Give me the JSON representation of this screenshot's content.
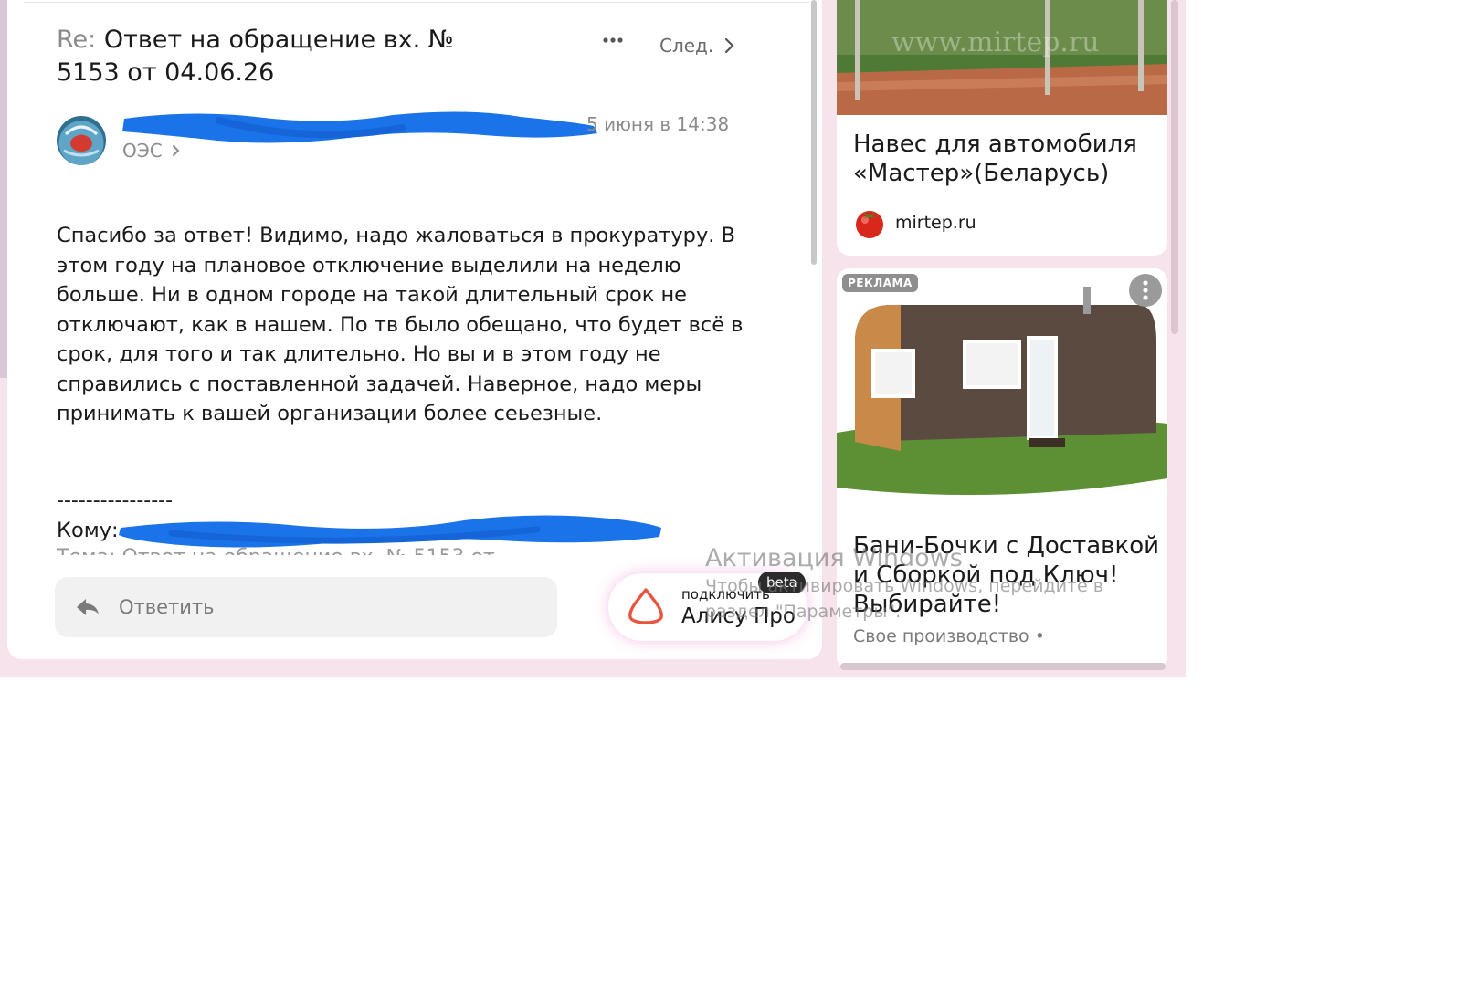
{
  "email": {
    "subject_prefix": "Re:",
    "subject": " Ответ на обращение вх. № 5153 от 04.06.26",
    "next_label": "След.",
    "date": "5 июня в 14:38",
    "recipient": "ОЭС",
    "body": "Спасибо за ответ! Видимо, надо жаловаться в прокуратуру. В этом году на плановое отключение выделили на неделю больше. Ни в одном городе на такой длительный срок не отключают, как в нашем. По тв было обещано, что будет всё в срок, для того и так длительно. Но вы и в этом году не справились с поставленной задачей. Наверное, надо меры принимать к вашей организации более сеьезные.",
    "divider": "----------------",
    "to_label": "Кому:",
    "reply_label": "Ответить"
  },
  "alice": {
    "connect_label": "подключить",
    "product_label": "Алису Про",
    "beta_label": "beta",
    "accent_color": "#e8553c"
  },
  "ads": [
    {
      "title": "Навес для автомобиля «Мастер»(Беларусь)",
      "source": "mirtep.ru",
      "image_watermark": "www.mirtep.ru",
      "icon": "tomato-icon"
    },
    {
      "badge": "РЕКЛАМА",
      "title": "Бани-Бочки с Доставкой и Сборкой под Ключ! Выбирайте!",
      "source": "Свое производство •",
      "icon": "more-vertical-icon"
    }
  ],
  "watermark": {
    "title": "Активация Windows",
    "subtitle": "Чтобы активировать Windows, перейдите в раздел \"Параметры\"."
  },
  "colors": {
    "frame": "#f7e3ec",
    "redaction": "#1a73e8",
    "text": "#1a1a1a",
    "muted": "#8c8c8c"
  }
}
